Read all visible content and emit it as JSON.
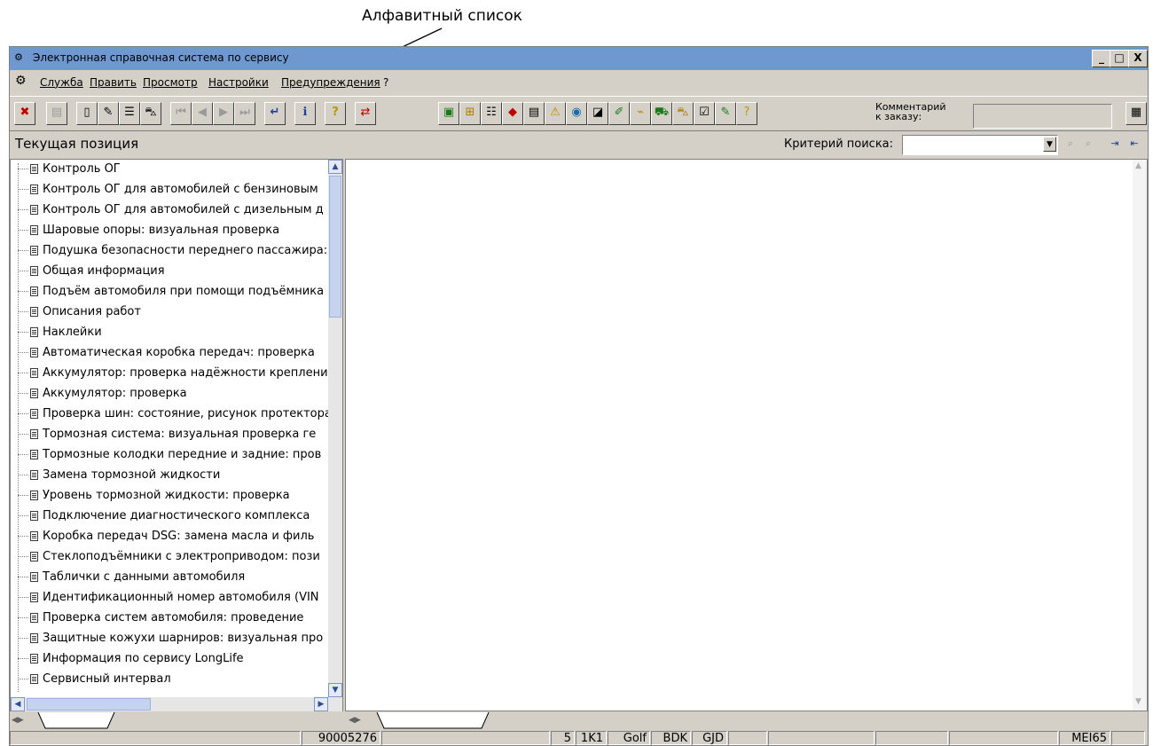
{
  "callout": "Алфавитный список",
  "window": {
    "title": "Электронная справочная система по сервису",
    "controls": [
      "_",
      "□",
      "X"
    ]
  },
  "menu": [
    "Служба",
    "Править",
    "Просмотр",
    "Настройки",
    "Предупреждения",
    "?"
  ],
  "toolbar": {
    "comment_label_1": "Комментарий",
    "comment_label_2": "к заказу:",
    "comment_value": ""
  },
  "position_bar": {
    "label": "Текущая позиция",
    "search_label": "Критерий поиска:",
    "search_value": ""
  },
  "tree": {
    "items": [
      "Контроль ОГ",
      "Контроль ОГ для автомобилей с бензиновым",
      "Контроль ОГ для автомобилей с дизельным д",
      "Шаровые опоры: визуальная проверка",
      "Подушка безопасности переднего пассажира:",
      "Общая информация",
      "Подъём автомобиля при помощи подъёмника",
      "Описания работ",
      "Наклейки",
      "Автоматическая коробка передач: проверка",
      "Аккумулятор: проверка надёжности крепления",
      "Аккумулятор: проверка",
      "Проверка шин: состояние, рисунок протектора",
      "Тормозная система: визуальная проверка ге",
      "Тормозные колодки передние и задние: пров",
      "Замена тормозной жидкости",
      "Уровень тормозной жидкости: проверка",
      "Подключение диагностического комплекса",
      "Коробка передач DSG: замена масла и филь",
      "Стеклоподъёмники с электроприводом: пози",
      "Таблички с данными автомобиля",
      "Идентификационный номер автомобиля (VIN",
      "Проверка систем автомобиля: проведение",
      "Защитные кожухи шарниров: визуальная про",
      "Информация по сервису LongLife",
      "Сервисный интервал"
    ]
  },
  "status": {
    "order": "90005276",
    "c1": "5",
    "c2": "1K1",
    "c3": "Golf",
    "c4": "BDK",
    "c5": "GJD",
    "c6": "MEI65"
  }
}
